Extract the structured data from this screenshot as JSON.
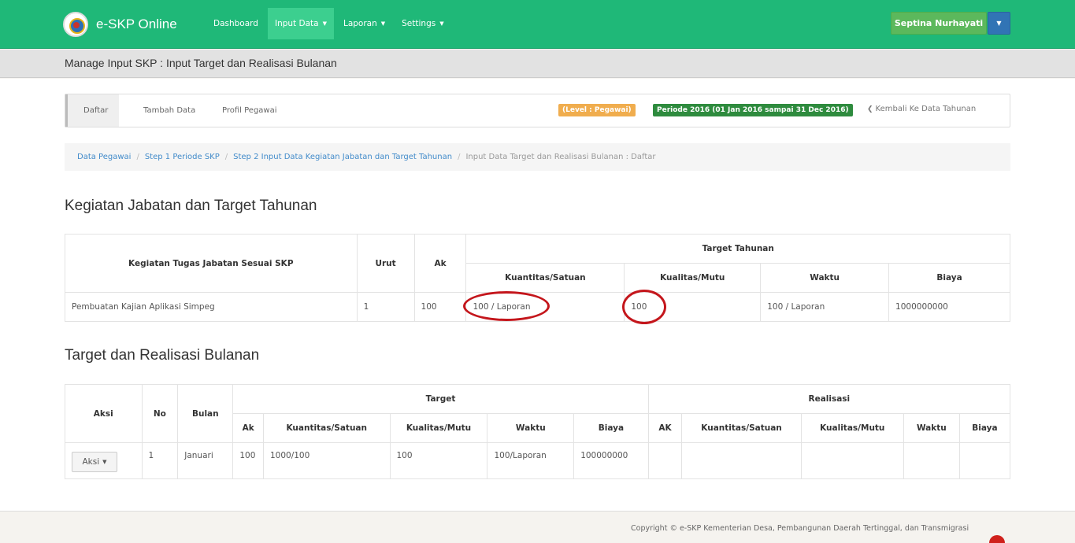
{
  "app": {
    "brand": "e-SKP Online"
  },
  "nav": {
    "dashboard": "Dashboard",
    "input_data": "Input Data",
    "laporan": "Laporan",
    "settings": "Settings",
    "caret": "▼"
  },
  "user": {
    "name": "Septina Nurhayati",
    "dropdown": "▼"
  },
  "page": {
    "title": "Manage Input SKP : Input Target dan Realisasi Bulanan"
  },
  "tabs": {
    "daftar": "Daftar",
    "tambah": "Tambah Data",
    "profil": "Profil Pegawai",
    "level": "(Level : Pegawai)",
    "periode": "Periode 2016 (01 Jan 2016 sampai 31 Dec 2016)",
    "back": "Kembali Ke Data Tahunan",
    "back_icon": "❮"
  },
  "breadcrumb": {
    "items": [
      "Data Pegawai",
      "Step 1 Periode SKP",
      "Step 2 Input Data Kegiatan Jabatan dan Target Tahunan"
    ],
    "separator": "/",
    "active": "Input Data Target dan Realisasi Bulanan : Daftar"
  },
  "section1": {
    "title": "Kegiatan Jabatan dan Target Tahunan",
    "headers": {
      "kegiatan": "Kegiatan Tugas Jabatan Sesuai SKP",
      "urut": "Urut",
      "ak": "Ak",
      "target_tahunan": "Target Tahunan",
      "kuantitas": "Kuantitas/Satuan",
      "kualitas": "Kualitas/Mutu",
      "waktu": "Waktu",
      "biaya": "Biaya"
    },
    "rows": [
      {
        "kegiatan": "Pembuatan Kajian Aplikasi Simpeg",
        "urut": "1",
        "ak": "100",
        "kuantitas": "100 / Laporan",
        "kualitas": "100",
        "waktu": "100 / Laporan",
        "biaya": "1000000000"
      }
    ]
  },
  "section2": {
    "title": "Target dan Realisasi Bulanan",
    "headers": {
      "aksi": "Aksi",
      "no": "No",
      "bulan": "Bulan",
      "target": "Target",
      "realisasi": "Realisasi",
      "t_ak": "Ak",
      "t_kuantitas": "Kuantitas/Satuan",
      "t_kualitas": "Kualitas/Mutu",
      "t_waktu": "Waktu",
      "t_biaya": "Biaya",
      "r_ak": "AK",
      "r_kuantitas": "Kuantitas/Satuan",
      "r_kualitas": "Kualitas/Mutu",
      "r_waktu": "Waktu",
      "r_biaya": "Biaya"
    },
    "rows": [
      {
        "aksi": "Aksi",
        "no": "1",
        "bulan": "Januari",
        "ak": "100",
        "kuantitas": "1000/100",
        "kualitas": "100",
        "waktu": "100/Laporan",
        "biaya": "100000000",
        "r_ak": "",
        "r_kuantitas": "",
        "r_kualitas": "",
        "r_waktu": "",
        "r_biaya": ""
      }
    ]
  },
  "footer": {
    "copyright": "Copyright © e-SKP Kementerian Desa, Pembangunan Daerah Tertinggal, dan Transmigrasi"
  }
}
